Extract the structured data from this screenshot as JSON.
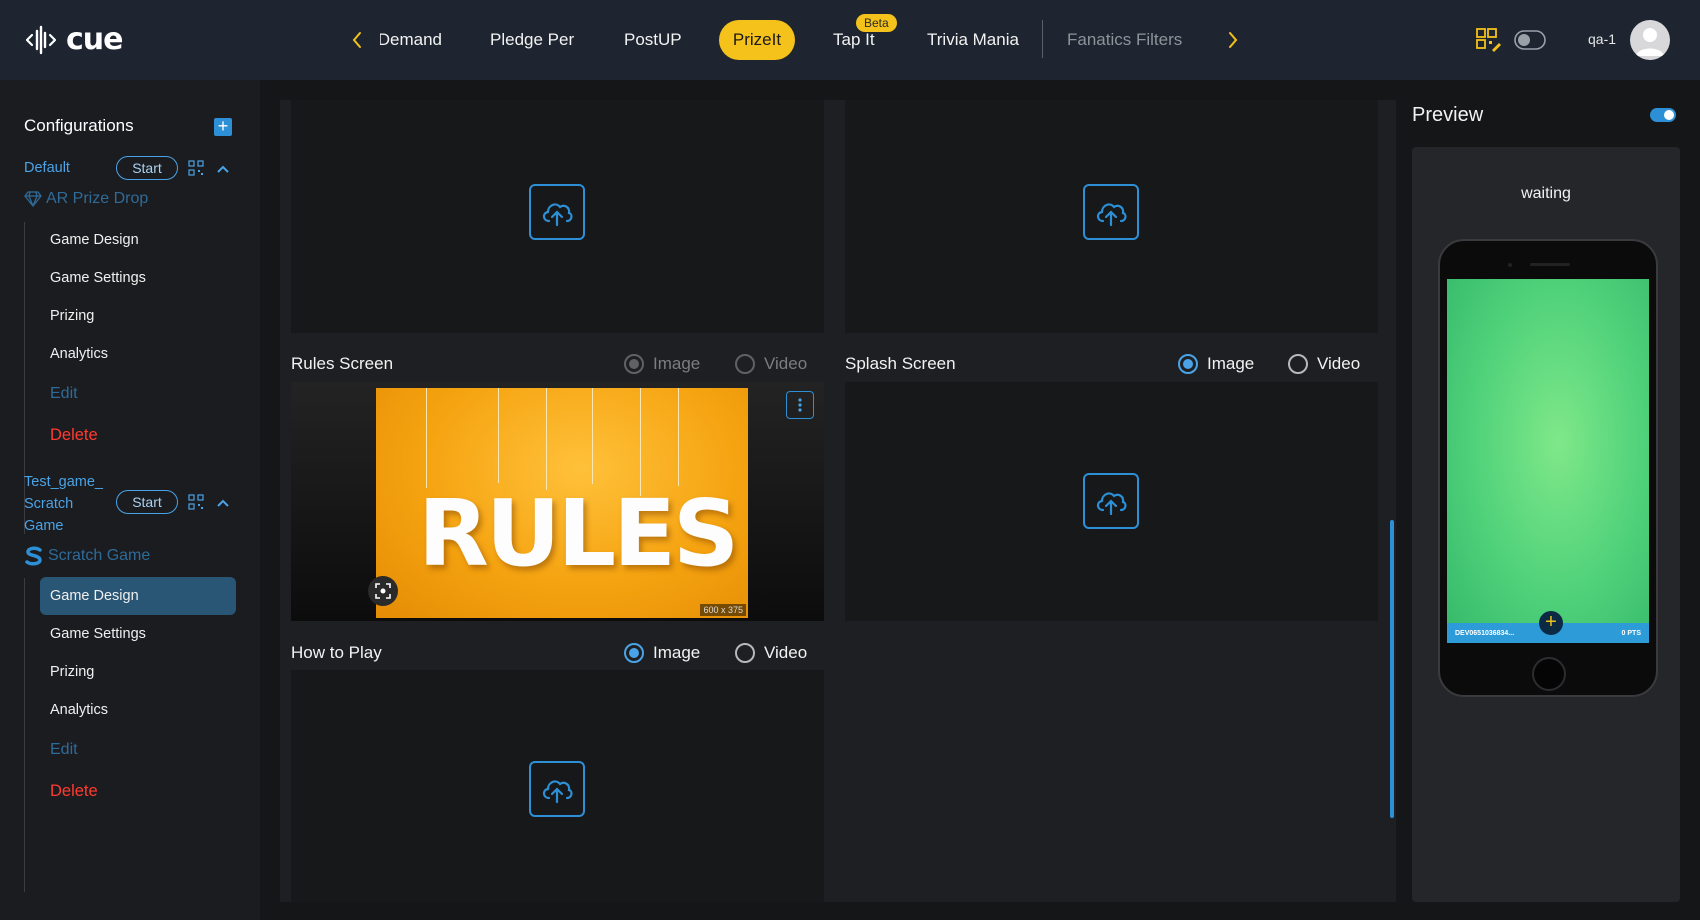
{
  "app": {
    "logo_text": "cue"
  },
  "topnav": {
    "tabs": [
      {
        "label": "Demand"
      },
      {
        "label": "Pledge Per"
      },
      {
        "label": "PostUP"
      },
      {
        "label": "PrizeIt"
      },
      {
        "label": "Tap It"
      },
      {
        "label": "Trivia Mania"
      },
      {
        "label": "Fanatics Filters"
      }
    ],
    "active_tab": "PrizeIt",
    "beta_badge": "Beta",
    "username": "qa-1"
  },
  "sidebar": {
    "title": "Configurations",
    "configs": [
      {
        "name": "Default",
        "start_label": "Start",
        "game_type": "AR Prize Drop",
        "items": [
          "Game Design",
          "Game Settings",
          "Prizing",
          "Analytics"
        ],
        "edit_label": "Edit",
        "delete_label": "Delete"
      },
      {
        "name_lines": [
          "Test_game_",
          "Scratch",
          "Game"
        ],
        "start_label": "Start",
        "game_type": "Scratch Game",
        "items": [
          "Game Design",
          "Game Settings",
          "Prizing",
          "Analytics"
        ],
        "selected_item": "Game Design",
        "edit_label": "Edit",
        "delete_label": "Delete"
      }
    ]
  },
  "main": {
    "sections": [
      {
        "label": "Rules Screen",
        "options": [
          "Image",
          "Video"
        ],
        "selected": "Image",
        "disabled": true,
        "image_text": "RULES",
        "image_size": "600 x 375"
      },
      {
        "label": "Splash Screen",
        "options": [
          "Image",
          "Video"
        ],
        "selected": "Image"
      },
      {
        "label": "How to Play",
        "options": [
          "Image",
          "Video"
        ],
        "selected": "Image"
      }
    ]
  },
  "preview": {
    "title": "Preview",
    "status": "waiting",
    "phone_bar_left": "DEV0651036834...",
    "phone_bar_right": "0 PTS"
  },
  "colors": {
    "accent": "#2d8fd6",
    "active_tab": "#f4c21a",
    "delete": "#ff3b30",
    "topbar": "#1e2530"
  }
}
